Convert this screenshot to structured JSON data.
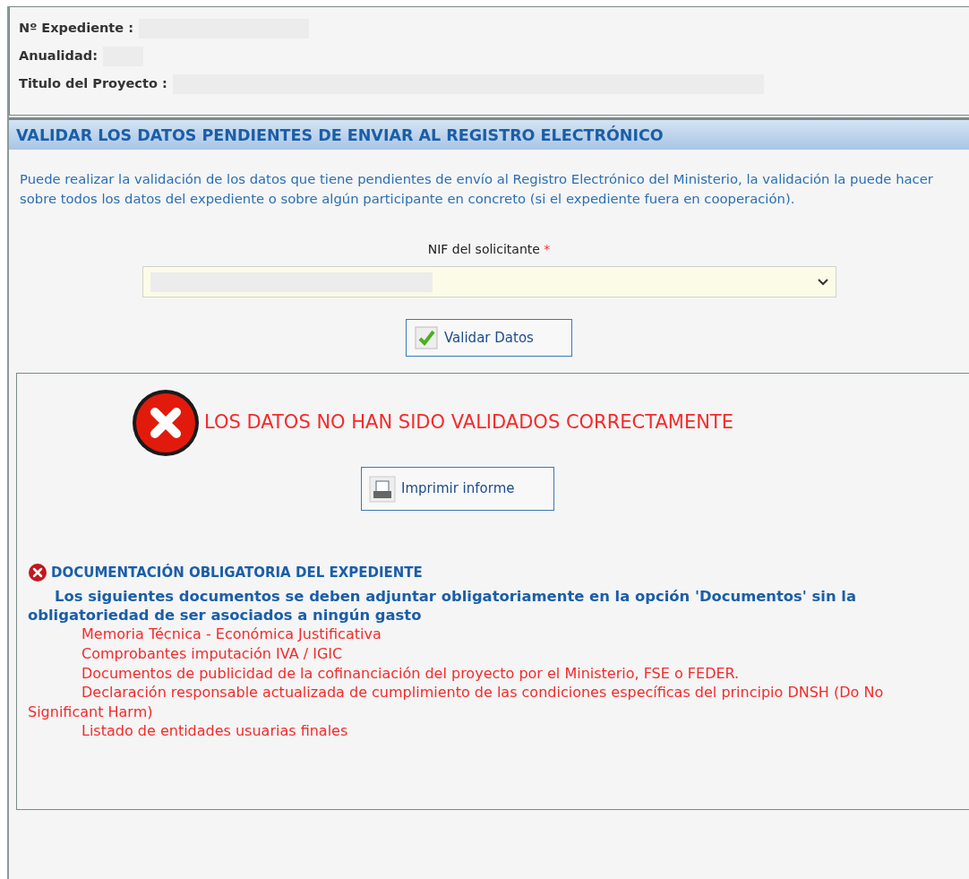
{
  "header": {
    "fields": [
      {
        "label": "Nº Expediente :"
      },
      {
        "label": "Anualidad:"
      },
      {
        "label": "Titulo del Proyecto :"
      }
    ]
  },
  "section": {
    "title": "VALIDAR LOS DATOS PENDIENTES DE ENVIAR AL REGISTRO ELECTRÓNICO",
    "intro": "Puede realizar la validación de los datos que tiene pendientes de envío al Registro Electrónico del Ministerio, la validación la puede hacer sobre todos los datos del expediente o sobre algún participante en concreto (si el expediente fuera en cooperación)."
  },
  "form": {
    "label": "NIF del solicitante",
    "required_mark": "*",
    "button": "Validar Datos"
  },
  "result": {
    "message": "LOS DATOS NO HAN SIDO VALIDADOS CORRECTAMENTE",
    "print_button": "Imprimir informe",
    "group": {
      "title": "DOCUMENTACIÓN OBLIGATORIA DEL EXPEDIENTE",
      "description": "Los siguientes documentos se deben adjuntar obligatoriamente en la opción 'Documentos' sin la obligatoriedad de ser asociados a ningún gasto",
      "items": [
        "Memoria Técnica - Económica Justificativa",
        "Comprobantes imputación IVA / IGIC",
        "Documentos de publicidad de la cofinanciación del proyecto por el Ministerio, FSE o FEDER.",
        "Declaración responsable actualizada de cumplimiento de las condiciones específicas del principio DNSH (Do No Significant Harm)",
        "Listado de entidades usuarias finales"
      ]
    }
  }
}
